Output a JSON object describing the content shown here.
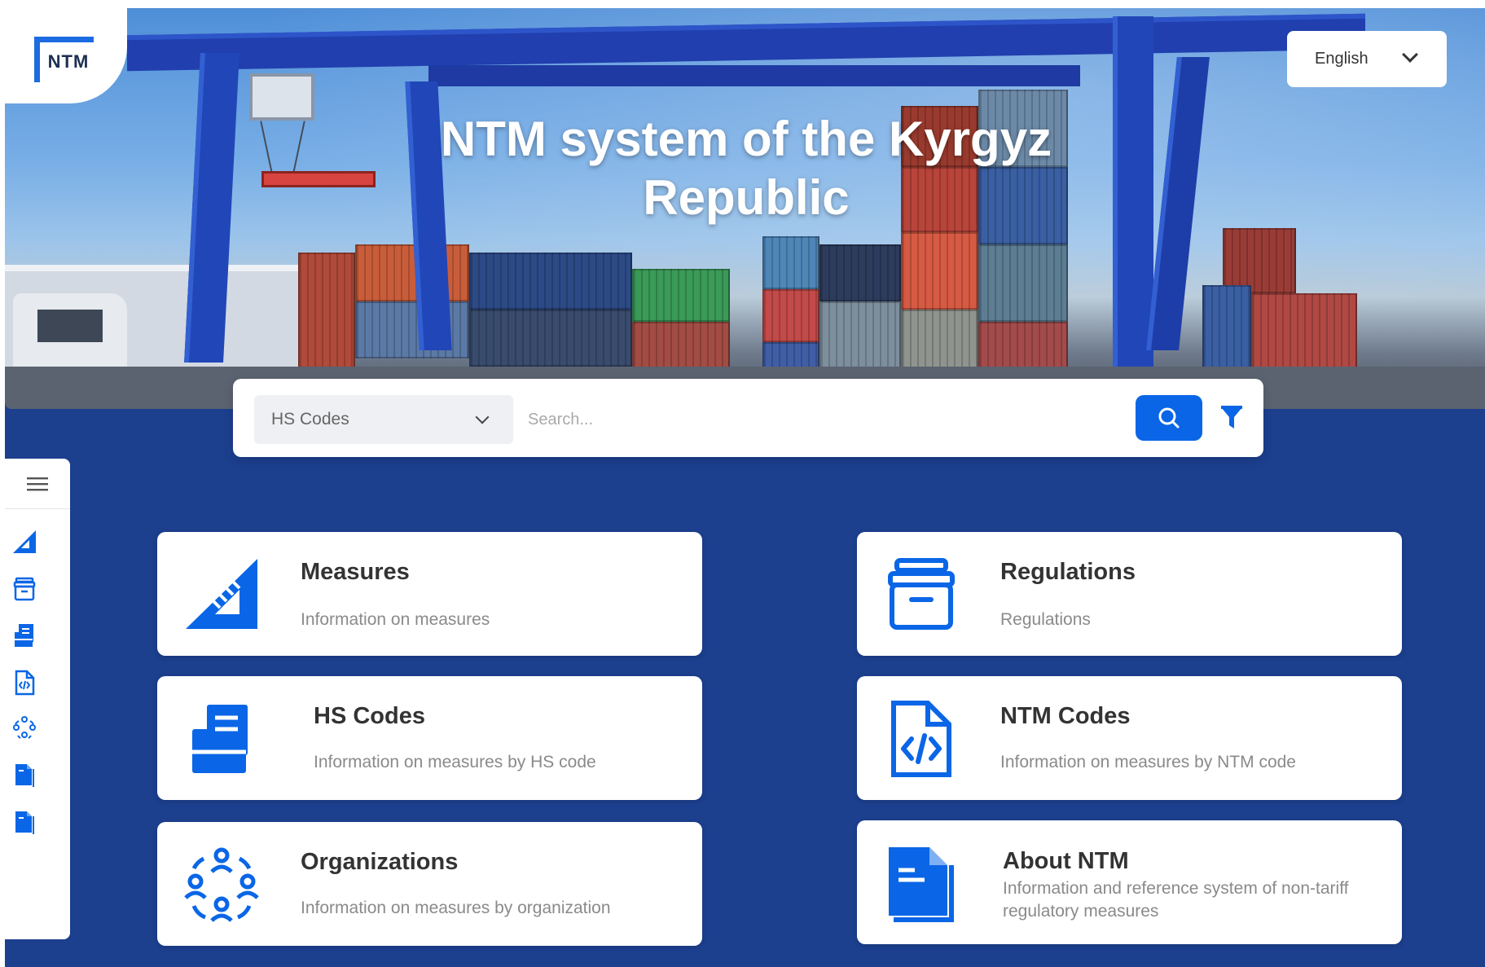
{
  "header": {
    "logo_text": "NTM",
    "title_line1": "NTM system of the Kyrgyz",
    "title_line2": "Republic",
    "language": "English"
  },
  "search": {
    "category": "HS Codes",
    "placeholder": "Search..."
  },
  "icons": {
    "menu": "hamburger-icon",
    "search": "search-icon",
    "filter": "filter-icon",
    "sidebar": [
      "ruler-triangle-icon",
      "archive-box-icon",
      "hs-folder-icon",
      "code-file-icon",
      "people-circle-icon",
      "document-icon",
      "document-icon"
    ]
  },
  "colors": {
    "primary": "#0a66e6",
    "page_background": "#1c3f8e",
    "card_background": "#ffffff"
  },
  "cards": [
    {
      "title": "Measures",
      "description": "Information on measures",
      "icon": "ruler-triangle-icon"
    },
    {
      "title": "Regulations",
      "description": "Regulations",
      "icon": "archive-box-icon"
    },
    {
      "title": "HS Codes",
      "description": "Information on measures by HS code",
      "icon": "hs-folder-icon"
    },
    {
      "title": "NTM Codes",
      "description": "Information on measures by NTM code",
      "icon": "code-file-icon"
    },
    {
      "title": "Organizations",
      "description": "Information on measures by organization",
      "icon": "people-circle-icon"
    },
    {
      "title": "About NTM",
      "description": "Information and reference system of non-tariff regulatory measures",
      "icon": "document-icon"
    }
  ]
}
